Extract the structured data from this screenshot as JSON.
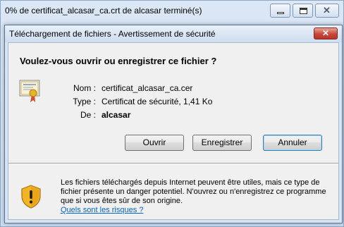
{
  "progress_window": {
    "title": "0% de certificat_alcasar_ca.crt de alcasar terminé(s)",
    "close_glyph": "✕"
  },
  "dialog": {
    "title": "Téléchargement de fichiers - Avertissement de sécurité",
    "close_glyph": "✕",
    "question": "Voulez-vous ouvrir ou enregistrer ce fichier ?",
    "file_info": {
      "name_label": "Nom :",
      "name_value": "certificat_alcasar_ca.cer",
      "type_label": "Type :",
      "type_value": "Certificat de sécurité, 1,41 Ko",
      "from_label": "De :",
      "from_value": "alcasar"
    },
    "buttons": {
      "open": "Ouvrir",
      "save": "Enregistrer",
      "cancel": "Annuler"
    },
    "warning": {
      "text": "Les fichiers téléchargés depuis Internet peuvent être utiles, mais ce type de fichier présente un danger potentiel. N'ouvrez ou n'enregistrez ce programme que si vous êtes sûr de son origine.",
      "link": "Quels sont les risques ?"
    }
  },
  "icons": {
    "file": "certificate-icon",
    "warning": "shield-warning-icon"
  },
  "colors": {
    "dialog_close": "#c9473a",
    "link": "#0066cc",
    "shield": "#e8a21a"
  }
}
